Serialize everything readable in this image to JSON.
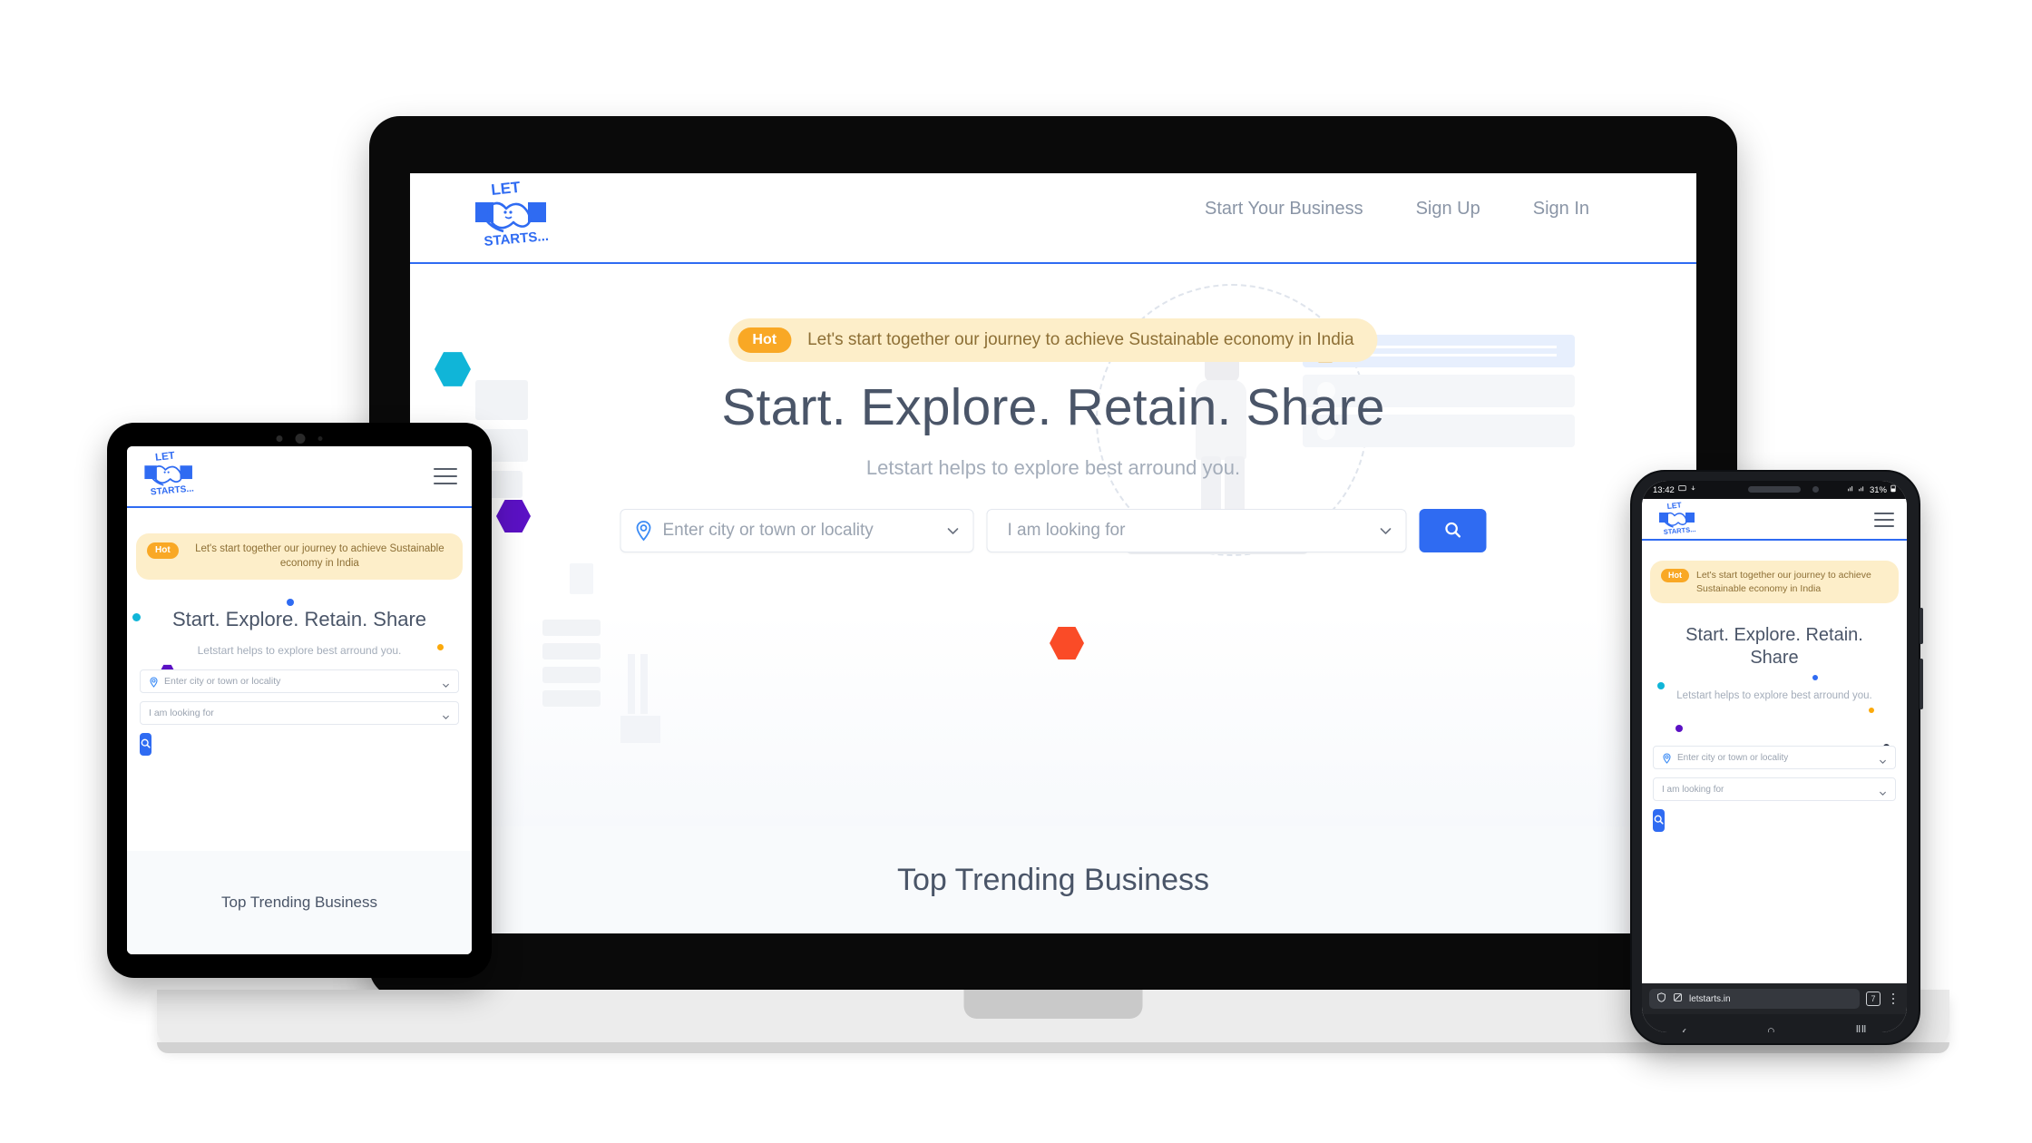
{
  "brand": {
    "logo_top_text": "LET",
    "logo_bottom_text": "STARTS...",
    "logo_icon": "handshake-icon",
    "primary_color": "#2f6bf2",
    "banner_bg_color": "#fdeec9",
    "hot_badge_color": "#f9a825"
  },
  "desktop": {
    "nav": {
      "links": [
        {
          "label": "Start Your Business"
        },
        {
          "label": "Sign Up"
        },
        {
          "label": "Sign In"
        }
      ]
    },
    "banner": {
      "badge": "Hot",
      "text": "Let's start together our journey to achieve Sustainable economy in India"
    },
    "hero": {
      "heading": "Start. Explore. Retain. Share",
      "subheading": "Letstart helps to explore best arround you."
    },
    "search": {
      "location_placeholder": "Enter city or town or locality",
      "category_placeholder": "I am looking for",
      "location_icon": "map-pin-icon",
      "chevron_icon": "chevron-down-icon",
      "button_icon": "search-icon"
    },
    "section": {
      "trending_title": "Top Trending Business"
    }
  },
  "tablet": {
    "menu_icon": "hamburger-menu-icon",
    "banner": {
      "badge": "Hot",
      "text": "Let's start together our journey to achieve Sustainable economy in India"
    },
    "hero": {
      "heading": "Start. Explore. Retain. Share",
      "subheading": "Letstart helps to explore best arround you."
    },
    "search": {
      "location_placeholder": "Enter city or town or locality",
      "category_placeholder": "I am looking for",
      "button_icon": "search-icon"
    },
    "section": {
      "trending_title": "Top Trending Business"
    }
  },
  "phone": {
    "status_bar": {
      "time": "13:42",
      "battery": "31%",
      "icons": [
        "screen-cast-icon",
        "download-icon",
        "wifi-icon",
        "signal-icon",
        "battery-icon"
      ]
    },
    "menu_icon": "hamburger-menu-icon",
    "banner": {
      "badge": "Hot",
      "text": "Let's start together our journey to achieve Sustainable economy in India"
    },
    "hero": {
      "heading": "Start. Explore. Retain. Share",
      "subheading": "Letstart helps to explore best arround you."
    },
    "search": {
      "location_placeholder": "Enter city or town or locality",
      "category_placeholder": "I am looking for",
      "button_icon": "search-icon"
    },
    "browser": {
      "url": "letstarts.in",
      "shield_icon": "shield-icon",
      "reader_icon": "reader-mode-icon",
      "tab_count": "7",
      "menu_icon": "kebab-menu-icon"
    },
    "system_nav": {
      "back": "‹",
      "home": "○",
      "recents": "‖‖"
    }
  },
  "decorations": {
    "hex_cyan": "#10b5d8",
    "hex_blue": "#2f6bf2",
    "hex_purple": "#5b11c4",
    "hex_orange_red": "#fa4b27",
    "hex_amber": "#fba90b"
  }
}
